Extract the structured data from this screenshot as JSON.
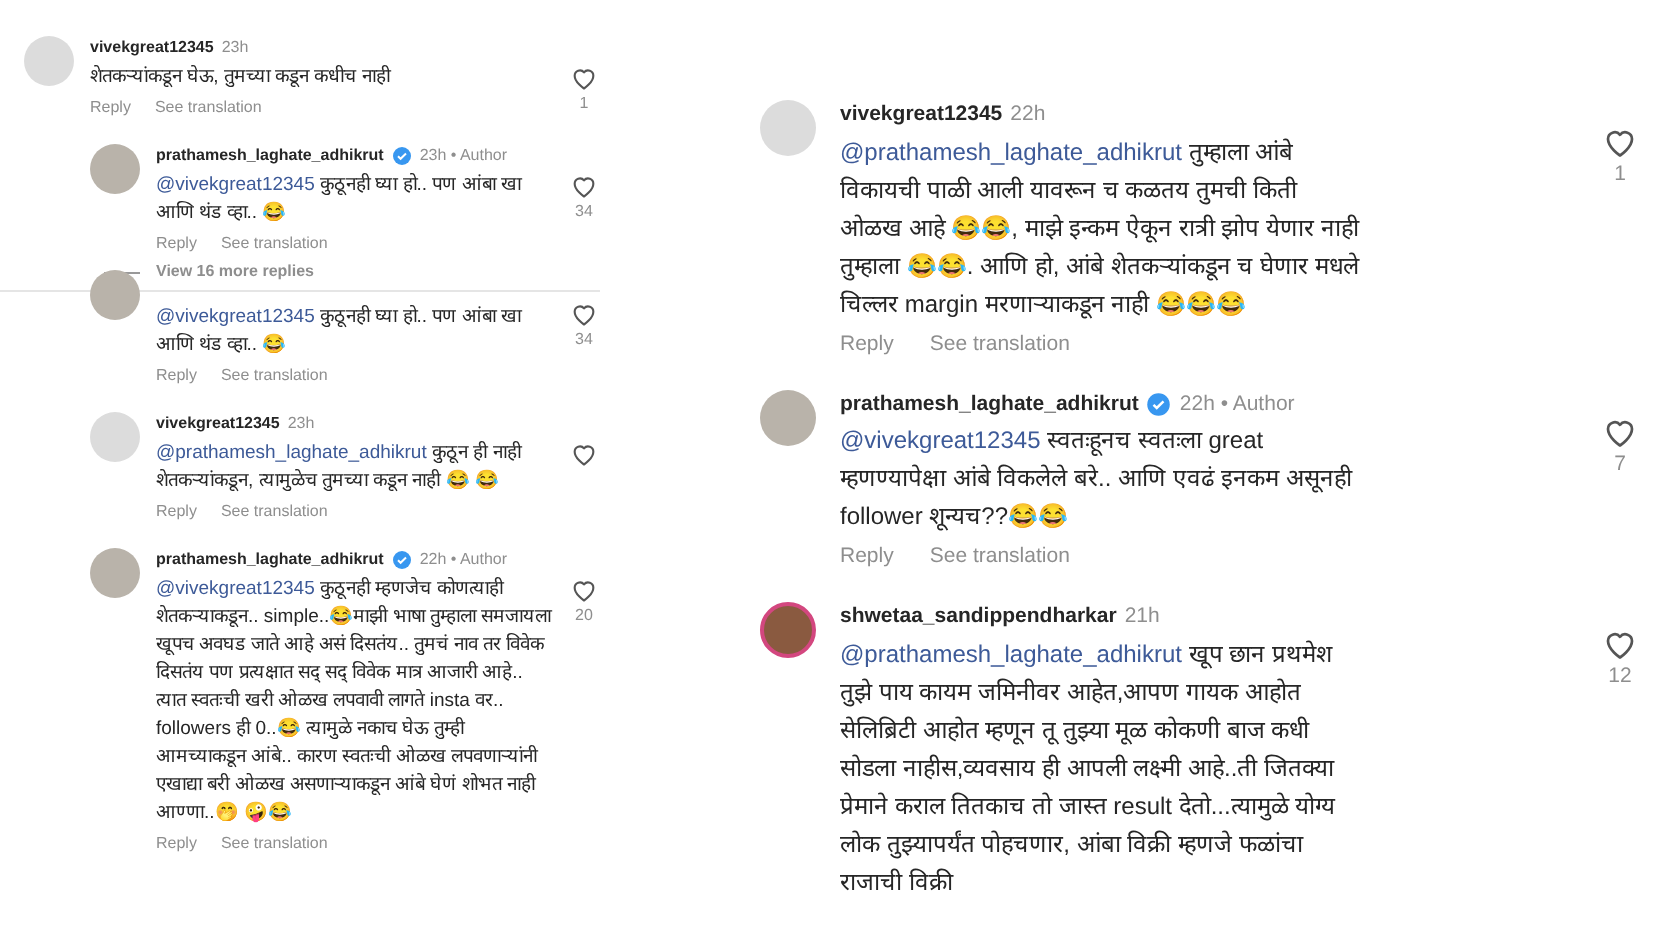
{
  "left_panel": {
    "items": [
      {
        "kind": "comment",
        "has_photo": false,
        "story_ring": false,
        "username": "vivekgreat12345",
        "verified": false,
        "time": "23h",
        "text": "शेतकऱ्यांकडून घेऊ, तुमच्या कडून कधीच नाही",
        "likes": "1",
        "actions": [
          "Reply",
          "See translation"
        ]
      },
      {
        "kind": "reply",
        "has_photo": true,
        "story_ring": false,
        "username": "prathamesh_laghate_adhikrut",
        "verified": true,
        "time": "23h",
        "author_label": "• Author",
        "mention": "@vivekgreat12345",
        "text": "कुठूनही घ्या हो.. पण आंबा खा आणि थंड व्हा.. 😂",
        "likes": "34",
        "actions": [
          "Reply",
          "See translation"
        ]
      },
      {
        "kind": "more_replies",
        "label": "View 16 more replies"
      },
      {
        "kind": "fragment",
        "has_photo": true,
        "story_ring": false,
        "mention": "@vivekgreat12345",
        "text": "कुठूनही घ्या हो.. पण आंबा खा आणि थंड व्हा.. 😂",
        "likes": "34",
        "actions": [
          "Reply",
          "See translation"
        ]
      },
      {
        "kind": "reply",
        "has_photo": false,
        "story_ring": false,
        "username": "vivekgreat12345",
        "verified": false,
        "time": "23h",
        "mention": "@prathamesh_laghate_adhikrut",
        "text": "कुठून ही नाही शेतकऱ्यांकडून, त्यामुळेच तुमच्या कडून नाही 😂 😂",
        "actions": [
          "Reply",
          "See translation"
        ]
      },
      {
        "kind": "reply",
        "has_photo": true,
        "story_ring": false,
        "username": "prathamesh_laghate_adhikrut",
        "verified": true,
        "time": "22h",
        "author_label": "• Author",
        "mention": "@vivekgreat12345",
        "text": "कुठूनही म्हणजेच कोणत्याही शेतकऱ्याकडून.. simple..😂माझी भाषा तुम्हाला समजायला खूपच अवघड जाते आहे असं दिसतंय.. तुमचं नाव तर विवेक दिसतंय पण प्रत्यक्षात सद् सद् विवेक मात्र आजारी आहे.. त्यात स्वतःची खरी ओळख लपवावी लागते insta वर.. followers ही 0..😂 त्यामुळे नकाच घेऊ तुम्ही आमच्याकडून आंबे.. कारण स्वतःची ओळख लपवणाऱ्यांनी एखाद्या बरी ओळख असणाऱ्याकडून आंबे घेणं शोभत नाही आण्णा..🤭 🤪😂",
        "likes": "20",
        "actions": [
          "Reply",
          "See translation"
        ]
      }
    ]
  },
  "right_panel": {
    "items": [
      {
        "kind": "comment",
        "has_photo": false,
        "story_ring": false,
        "username": "vivekgreat12345",
        "verified": false,
        "time": "22h",
        "mention": "@prathamesh_laghate_adhikrut",
        "text": "तुम्हाला आंबे विकायची पाळी आली यावरून च कळतय तुमची किती ओळख आहे 😂😂, माझे इन्कम ऐकून रात्री झोप येणार नाही तुम्हाला 😂😂. आणि हो, आंबे शेतकऱ्यांकडून च घेणार मधले चिल्लर margin मरणाऱ्याकडून नाही 😂😂😂",
        "likes": "1",
        "actions": [
          "Reply",
          "See translation"
        ]
      },
      {
        "kind": "comment",
        "has_photo": true,
        "story_ring": false,
        "username": "prathamesh_laghate_adhikrut",
        "verified": true,
        "time": "22h",
        "author_label": "• Author",
        "mention": "@vivekgreat12345",
        "text": "स्वतःहूनच स्वतःला great म्हणण्यापेक्षा आंबे विकलेले बरे.. आणि एवढं इनकम असूनही follower शून्यच??😂😂",
        "likes": "7",
        "actions": [
          "Reply",
          "See translation"
        ]
      },
      {
        "kind": "comment",
        "has_photo": true,
        "story_ring": true,
        "username": "shwetaa_sandippendharkar",
        "verified": false,
        "time": "21h",
        "mention": "@prathamesh_laghate_adhikrut",
        "text": "खूप छान प्रथमेश तुझे पाय कायम जमिनीवर आहेत,आपण गायक आहोत सेलिब्रिटी आहोत म्हणून तू तुझ्या मूळ कोकणी बाज कधी सोडला नाहीस,व्यवसाय ही आपली लक्ष्मी आहे..ती जितक्या प्रेमाने कराल तितकाच तो जास्त result देतो...त्यामुळे योग्य लोक तुझ्यापर्यंत पोहचणार, आंबा विक्री म्हणजे फळांचा राजाची विक्री",
        "likes": "12"
      }
    ]
  }
}
